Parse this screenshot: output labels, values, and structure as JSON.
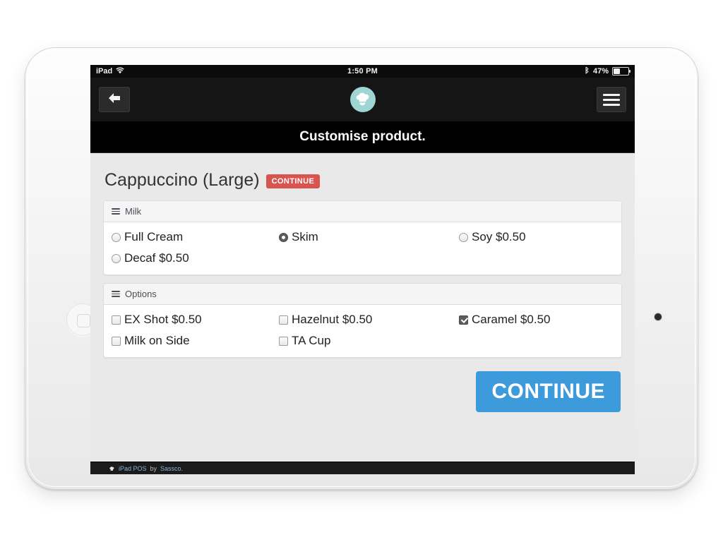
{
  "status_bar": {
    "carrier_label": "iPad",
    "wifi_icon": "wifi-icon",
    "time": "1:50 PM",
    "bluetooth_icon": "bluetooth-icon",
    "battery_percent": "47%"
  },
  "nav_bar": {
    "back_icon": "back-arrow-icon",
    "logo_icon": "chef-hat-logo-icon",
    "menu_icon": "hamburger-menu-icon"
  },
  "title_bar": {
    "title": "Customise product."
  },
  "product": {
    "name": "Cappuccino (Large)",
    "badge_label": "CONTINUE",
    "badge_color": "#d9534f"
  },
  "panels": [
    {
      "heading": "Milk",
      "icon": "list-icon",
      "control_type": "radio",
      "options": [
        {
          "label": "Full Cream",
          "checked": false
        },
        {
          "label": "Skim",
          "checked": true
        },
        {
          "label": "Soy $0.50",
          "checked": false
        },
        {
          "label": "Decaf $0.50",
          "checked": false
        }
      ]
    },
    {
      "heading": "Options",
      "icon": "list-icon",
      "control_type": "checkbox",
      "options": [
        {
          "label": "EX Shot $0.50",
          "checked": false
        },
        {
          "label": "Hazelnut $0.50",
          "checked": false
        },
        {
          "label": "Caramel $0.50",
          "checked": true
        },
        {
          "label": "Milk on Side",
          "checked": false
        },
        {
          "label": "TA Cup",
          "checked": false
        }
      ]
    }
  ],
  "actions": {
    "continue_label": "CONTINUE",
    "continue_color": "#3d9bdc"
  },
  "footer": {
    "hat_icon": "chef-hat-icon",
    "app_name": "iPad POS",
    "by_word": "by",
    "company": "Sassco."
  }
}
